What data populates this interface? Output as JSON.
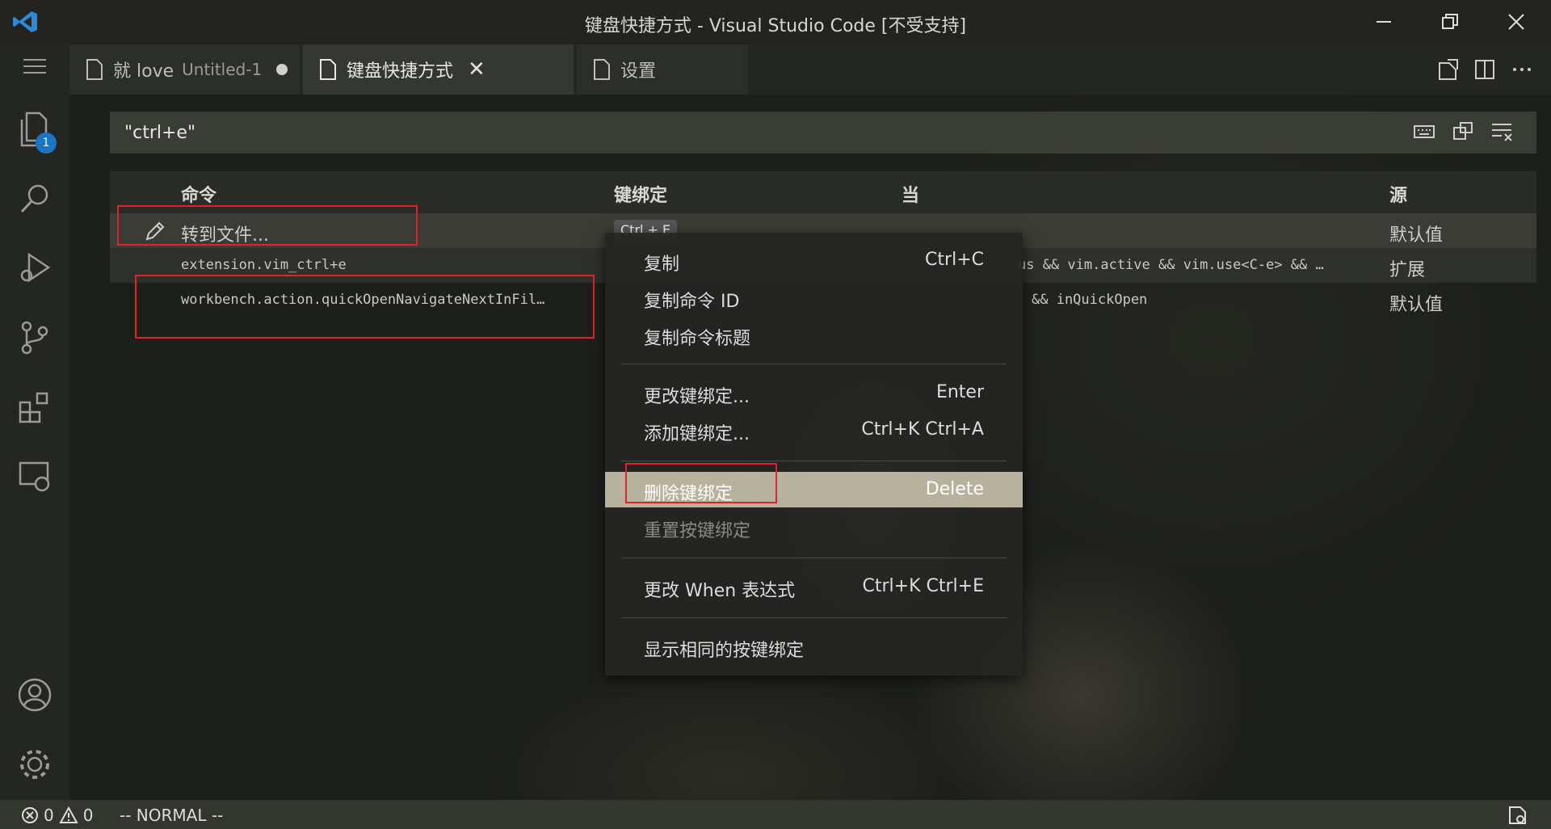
{
  "window": {
    "title": "键盘快捷方式 - Visual Studio Code [不受支持]"
  },
  "tabs": [
    {
      "label": "就 love",
      "sublabel": "Untitled-1",
      "dirty": true
    },
    {
      "label": "键盘快捷方式",
      "active": true
    },
    {
      "label": "设置"
    }
  ],
  "activity_bar": {
    "explorer_badge": "1"
  },
  "search": {
    "value": "\"ctrl+e\""
  },
  "table": {
    "headers": {
      "command": "命令",
      "keybinding": "键绑定",
      "when": "当",
      "source": "源"
    },
    "rows": [
      {
        "command": "转到文件...",
        "keybinding": "Ctrl + E",
        "when": "",
        "source": "默认值"
      },
      {
        "command": "extension.vim_ctrl+e",
        "keybinding": "",
        "when": "us && vim.active && vim.use<C-e> && …",
        "source": "扩展"
      },
      {
        "command": "workbench.action.quickOpenNavigateNextInFil…",
        "keybinding": "",
        "when": "&& inQuickOpen",
        "source": "默认值"
      }
    ]
  },
  "context_menu": {
    "items": [
      {
        "label": "复制",
        "key": "Ctrl+C"
      },
      {
        "label": "复制命令 ID",
        "key": ""
      },
      {
        "label": "复制命令标题",
        "key": ""
      },
      {
        "label": "更改键绑定...",
        "key": "Enter"
      },
      {
        "label": "添加键绑定...",
        "key": "Ctrl+K Ctrl+A"
      },
      {
        "label": "删除键绑定",
        "key": "Delete",
        "highlighted": true
      },
      {
        "label": "重置按键绑定",
        "key": "",
        "disabled": true
      },
      {
        "label": "更改 When 表达式",
        "key": "Ctrl+K Ctrl+E"
      },
      {
        "label": "显示相同的按键绑定",
        "key": ""
      }
    ]
  },
  "statusbar": {
    "errors": "0",
    "warnings": "0",
    "mode": "-- NORMAL --"
  },
  "colors": {
    "accent_badge": "#1976c7",
    "annotation_red": "#e0232a",
    "menu_highlight": "#b7b29d"
  }
}
